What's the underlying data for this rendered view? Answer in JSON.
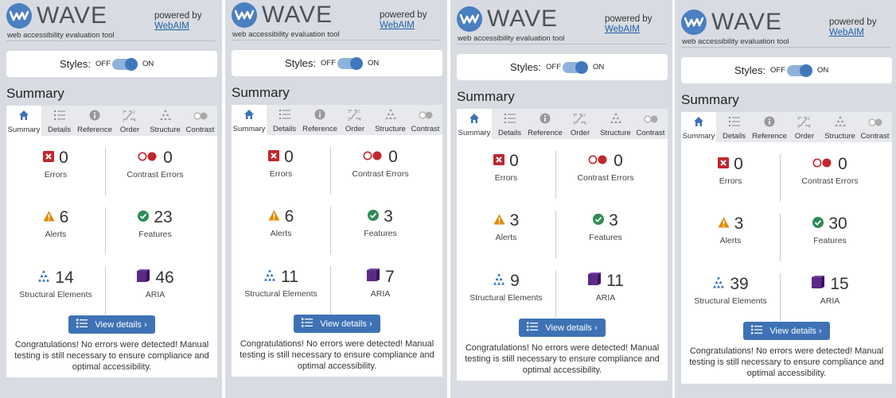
{
  "header": {
    "logo_text": "WAVE",
    "tagline": "web accessibility evaluation tool",
    "powered_by": "powered by",
    "webaim_link": "WebAIM"
  },
  "styles": {
    "label": "Styles:",
    "off": "OFF",
    "on": "ON",
    "state": "on"
  },
  "summary_title": "Summary",
  "tabs": [
    "Summary",
    "Details",
    "Reference",
    "Order",
    "Structure",
    "Contrast"
  ],
  "stat_labels": {
    "errors": "Errors",
    "contrast_errors": "Contrast Errors",
    "alerts": "Alerts",
    "features": "Features",
    "structural": "Structural Elements",
    "aria": "ARIA"
  },
  "view_details": "View details ›",
  "congrats": "Congratulations! No errors were detected! Manual testing is still necessary to ensure compliance and optimal accessibility.",
  "colors": {
    "accent": "#3e72b5",
    "error": "#c0272d",
    "alert": "#e08a00",
    "feature": "#2e8b57",
    "structural": "#2a6ebb",
    "aria": "#5b2a86"
  },
  "panels": [
    {
      "errors": "0",
      "contrast_errors": "0",
      "alerts": "6",
      "features": "23",
      "structural": "14",
      "aria": "46"
    },
    {
      "errors": "0",
      "contrast_errors": "0",
      "alerts": "6",
      "features": "3",
      "structural": "11",
      "aria": "7"
    },
    {
      "errors": "0",
      "contrast_errors": "0",
      "alerts": "3",
      "features": "3",
      "structural": "9",
      "aria": "11"
    },
    {
      "errors": "0",
      "contrast_errors": "0",
      "alerts": "3",
      "features": "30",
      "structural": "39",
      "aria": "15"
    }
  ]
}
